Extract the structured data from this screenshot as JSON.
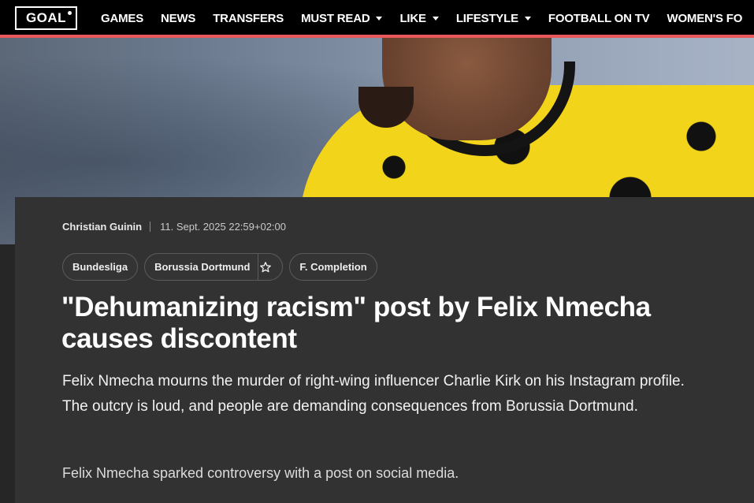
{
  "nav": {
    "logo_text": "GOAL",
    "items": [
      {
        "label": "GAMES",
        "dropdown": false
      },
      {
        "label": "NEWS",
        "dropdown": false
      },
      {
        "label": "TRANSFERS",
        "dropdown": false
      },
      {
        "label": "MUST READ",
        "dropdown": true
      },
      {
        "label": "LIKE",
        "dropdown": true
      },
      {
        "label": "LIFESTYLE",
        "dropdown": true
      },
      {
        "label": "FOOTBALL ON TV",
        "dropdown": false
      },
      {
        "label": "WOMEN'S FO",
        "dropdown": false
      }
    ],
    "accent_color": "#e8585b"
  },
  "article": {
    "author": "Christian Guinin",
    "date": "11. Sept. 2025 22:59+02:00",
    "tags": {
      "t1": "Bundesliga",
      "t2": "Borussia Dortmund",
      "t2_icon": "star-outline-icon",
      "t3": "F. Completion"
    },
    "headline": "\"Dehumanizing racism\" post by Felix Nmecha causes discontent",
    "lede": "Felix Nmecha mourns the murder of right-wing influencer Charlie Kirk on his Instagram profile. The outcry is loud, and people are demanding consequences from Borussia Dortmund.",
    "body_first": "Felix Nmecha sparked controversy with a post on social media."
  }
}
